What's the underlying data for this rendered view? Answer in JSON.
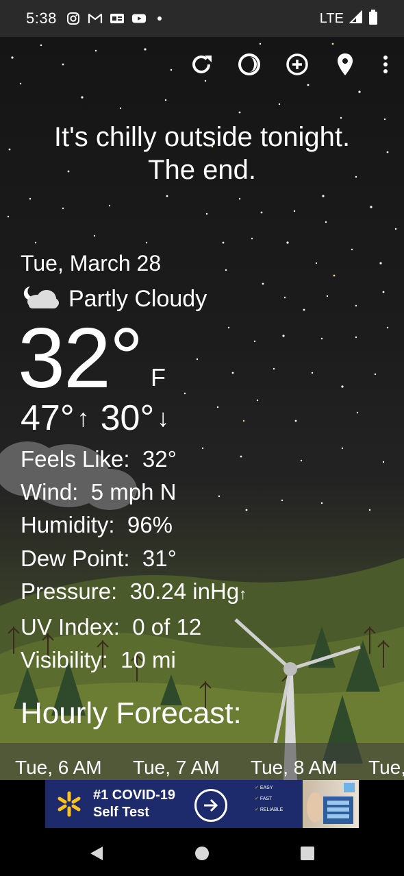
{
  "status_bar": {
    "time": "5:38",
    "network": "LTE",
    "notif_icons": [
      "instagram-icon",
      "gmail-icon",
      "news-icon",
      "youtube-icon"
    ]
  },
  "toolbar": {
    "icons": [
      "refresh-icon",
      "moon-phase-icon",
      "add-location-icon",
      "location-pin-icon",
      "overflow-menu-icon"
    ]
  },
  "headline": {
    "line1": "It's chilly outside tonight.",
    "line2": "The end."
  },
  "current": {
    "date": "Tue, March 28",
    "condition": "Partly Cloudy",
    "condition_icon": "partly-cloudy-night-icon",
    "temperature": "32°",
    "unit": "F",
    "high": "47°",
    "low": "30°"
  },
  "details": [
    {
      "label": "Feels Like:",
      "value": "32°"
    },
    {
      "label": "Wind:",
      "value": "5 mph N"
    },
    {
      "label": "Humidity:",
      "value": "96%"
    },
    {
      "label": "Dew Point:",
      "value": "31°"
    },
    {
      "label": "Pressure:",
      "value": "30.24 inHg"
    },
    {
      "label": "UV Index:",
      "value": "0 of 12"
    },
    {
      "label": "Visibility:",
      "value": "10 mi"
    }
  ],
  "hourly": {
    "title": "Hourly Forecast:",
    "hours": [
      "Tue, 6 AM",
      "Tue, 7 AM",
      "Tue, 8 AM",
      "Tue,"
    ]
  },
  "ad": {
    "line1": "#1 COVID-19",
    "line2": "Self Test",
    "feature1": "EASY",
    "feature2": "FAST",
    "feature3": "RELIABLE",
    "brand_color": "#ffc220",
    "background": "#1d2a6b"
  },
  "nav": {
    "icons": [
      "back-icon",
      "home-icon",
      "recents-icon"
    ]
  }
}
